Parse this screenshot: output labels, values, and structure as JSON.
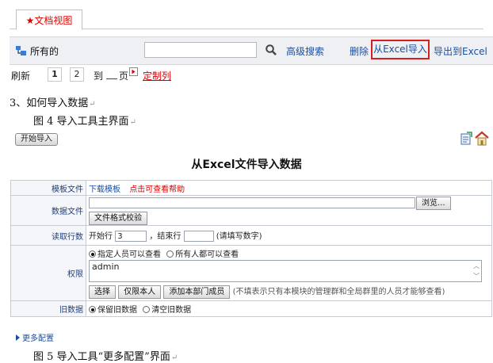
{
  "tab": {
    "label": "文档视图",
    "star": "★"
  },
  "toolbar": {
    "view_label": "所有的",
    "search_placeholder": "",
    "advanced_search": "高级搜索",
    "delete": "删除",
    "import_excel": "从Excel导入",
    "export_excel": "导出到Excel"
  },
  "pager": {
    "refresh": "刷新",
    "pages": [
      "1",
      "2"
    ],
    "to": "到",
    "page": "页",
    "custom_columns": "定制列"
  },
  "doc": {
    "heading": "3、如何导入数据",
    "caption4": "图 4 导入工具主界面",
    "caption5": "图 5 导入工具“更多配置”界面",
    "paragraph_mark": "↵"
  },
  "start_import": "开始导入",
  "form": {
    "title": "从Excel文件导入数据",
    "template": {
      "label": "模板文件",
      "download": "下载模板",
      "help": "点击可查看帮助"
    },
    "datafile": {
      "label": "数据文件",
      "browse": "浏览...",
      "check": "文件格式校验"
    },
    "rows": {
      "label": "读取行数",
      "start_label": "开始行",
      "start_value": "3",
      "end_label": "，结束行",
      "end_value": "",
      "hint": "(请填写数字)"
    },
    "perm": {
      "label": "权限",
      "opt_specified": "指定人员可以查看",
      "opt_all": "所有人都可以查看",
      "value": "admin",
      "select": "选择",
      "self_only": "仅限本人",
      "add_dept": "添加本部门成员",
      "note": "(不填表示只有本模块的管理群和全局群里的人员才能够查看)"
    },
    "old": {
      "label": "旧数据",
      "keep": "保留旧数据",
      "clear": "清空旧数据"
    }
  },
  "more_config": "更多配置",
  "colors": {
    "red": "#d00000",
    "link": "#1b4fa0",
    "label": "#1e3f7a",
    "highlight_border": "#d62020"
  }
}
